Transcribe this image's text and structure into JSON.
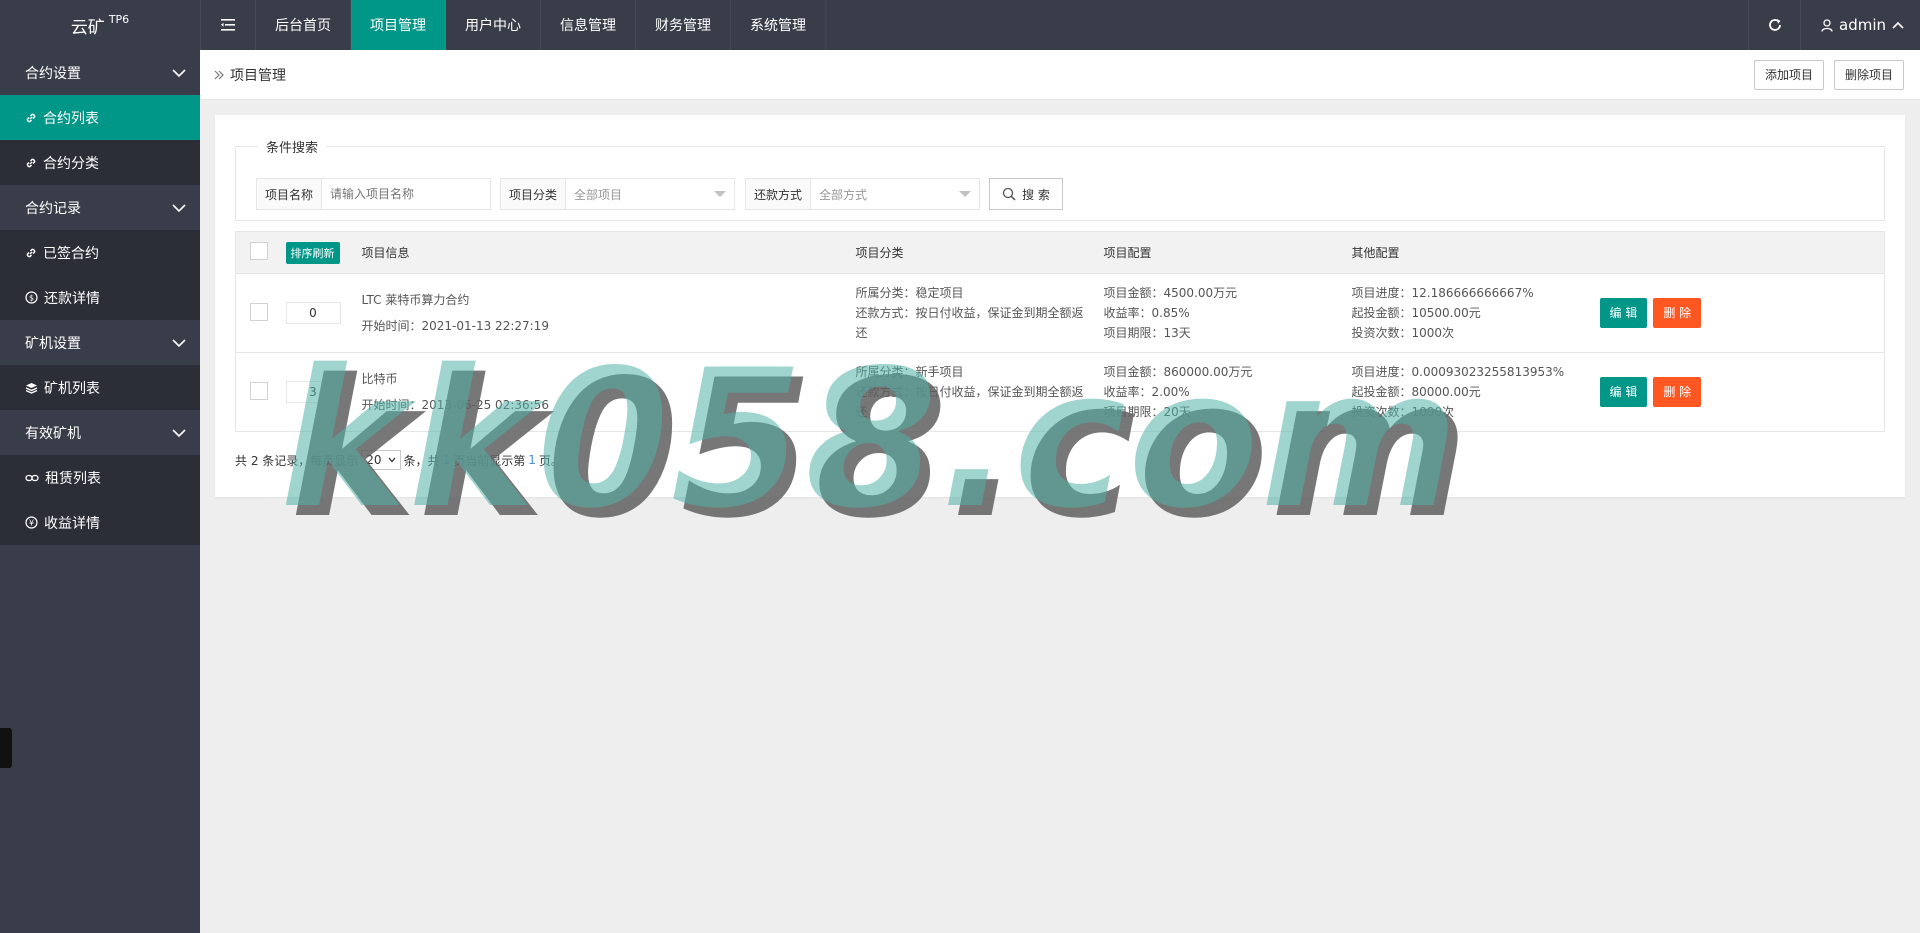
{
  "header": {
    "logo": "云矿",
    "logo_sup": "TP6",
    "nav": [
      "后台首页",
      "项目管理",
      "用户中心",
      "信息管理",
      "财务管理",
      "系统管理"
    ],
    "active_nav": "项目管理",
    "user": "admin"
  },
  "sidebar": {
    "groups": [
      {
        "label": "合约设置",
        "items": [
          {
            "label": "合约列表",
            "icon": "link-icon"
          },
          {
            "label": "合约分类",
            "icon": "link-icon"
          }
        ]
      },
      {
        "label": "合约记录",
        "items": [
          {
            "label": "已签合约",
            "icon": "link-icon"
          },
          {
            "label": "还款详情",
            "icon": "dollar-icon"
          }
        ]
      },
      {
        "label": "矿机设置",
        "items": [
          {
            "label": "矿机列表",
            "icon": "layers-icon"
          }
        ]
      },
      {
        "label": "有效矿机",
        "items": [
          {
            "label": "租赁列表",
            "icon": "chain-icon"
          },
          {
            "label": "收益详情",
            "icon": "yen-icon"
          }
        ]
      }
    ]
  },
  "page": {
    "breadcrumb": "项目管理",
    "add_btn": "添加项目",
    "delete_btn": "删除项目"
  },
  "search": {
    "legend": "条件搜索",
    "name_label": "项目名称",
    "name_placeholder": "请输入项目名称",
    "category_label": "项目分类",
    "category_value": "全部项目",
    "repay_label": "还款方式",
    "repay_value": "全部方式",
    "search_btn": "搜 索"
  },
  "table": {
    "sort_btn": "排序刷新",
    "headers": [
      "项目信息",
      "项目分类",
      "项目配置",
      "其他配置"
    ],
    "rows": [
      {
        "sort": "0",
        "title": "LTC 莱特币算力合约",
        "start": "开始时间：2021-01-13 22:27:19",
        "category": "所属分类：稳定项目",
        "repay": "还款方式：按日付收益，保证金到期全额返还",
        "amount": "项目金额：4500.00万元",
        "rate": "收益率：0.85%",
        "term": "项目期限：13天",
        "progress": "项目进度：12.186666666667%",
        "min_invest": "起投金额：10500.00元",
        "times": "投资次数：1000次"
      },
      {
        "sort": "3",
        "title": "比特币",
        "start": "开始时间：2013-06-25 02:36:56",
        "category": "所属分类：新手项目",
        "repay": "还款方式：按日付收益，保证金到期全额返还",
        "amount": "项目金额：860000.00万元",
        "rate": "收益率：2.00%",
        "term": "项目期限：20天",
        "progress": "项目进度：0.00093023255813953%",
        "min_invest": "起投金额：80000.00元",
        "times": "投资次数：1000次"
      }
    ],
    "edit_btn": "编 辑",
    "delete_btn": "删 除"
  },
  "pager": {
    "pre": "共 2 条记录，每页显示",
    "page_size": "20",
    "mid": "条，共",
    "pages": "1",
    "post": "页当前显示第",
    "current": "1",
    "end": "页。"
  },
  "watermark": "kk058.com"
}
